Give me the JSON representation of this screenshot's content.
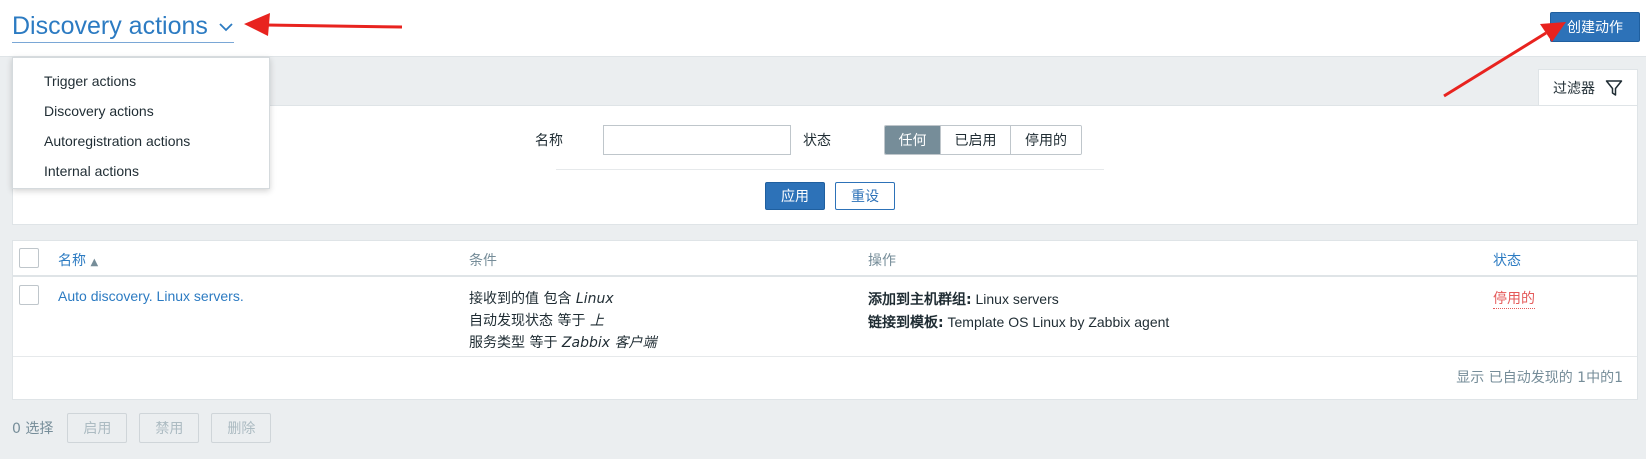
{
  "header": {
    "title": "Discovery actions",
    "create_button": "创建动作"
  },
  "dropdown": {
    "items": [
      "Trigger actions",
      "Discovery actions",
      "Autoregistration actions",
      "Internal actions"
    ]
  },
  "filter": {
    "tab_label": "过滤器",
    "name_label": "名称",
    "name_value": "",
    "status_label": "状态",
    "status_options": [
      "任何",
      "已启用",
      "停用的"
    ],
    "status_selected": "任何",
    "apply_button": "应用",
    "reset_button": "重设"
  },
  "table": {
    "columns": {
      "name": "名称",
      "conditions": "条件",
      "operations": "操作",
      "status": "状态"
    },
    "sort_indicator": "▲",
    "rows": [
      {
        "name": "Auto discovery. Linux servers.",
        "conditions": [
          {
            "text": "接收到的值 包含 ",
            "value": "Linux"
          },
          {
            "text": "自动发现状态 等于 ",
            "value": "上"
          },
          {
            "text": "服务类型 等于 ",
            "value": "Zabbix 客户端"
          }
        ],
        "operations": [
          {
            "label": "添加到主机群组:",
            "value": " Linux servers"
          },
          {
            "label": "链接到模板:",
            "value": " Template OS Linux by Zabbix agent"
          }
        ],
        "status": "停用的"
      }
    ],
    "footer": "显示 已自动发现的 1中的1"
  },
  "bottom": {
    "selected_count": "0 选择",
    "buttons": [
      "启用",
      "禁用",
      "删除"
    ]
  },
  "colors": {
    "accent": "#2d72b8",
    "link": "#2c7bc2",
    "disabled_status": "#e45959",
    "annotation_arrow": "#e8231f"
  },
  "icons": [
    "chevron-down-icon",
    "filter-icon",
    "sort-ascending-icon"
  ]
}
